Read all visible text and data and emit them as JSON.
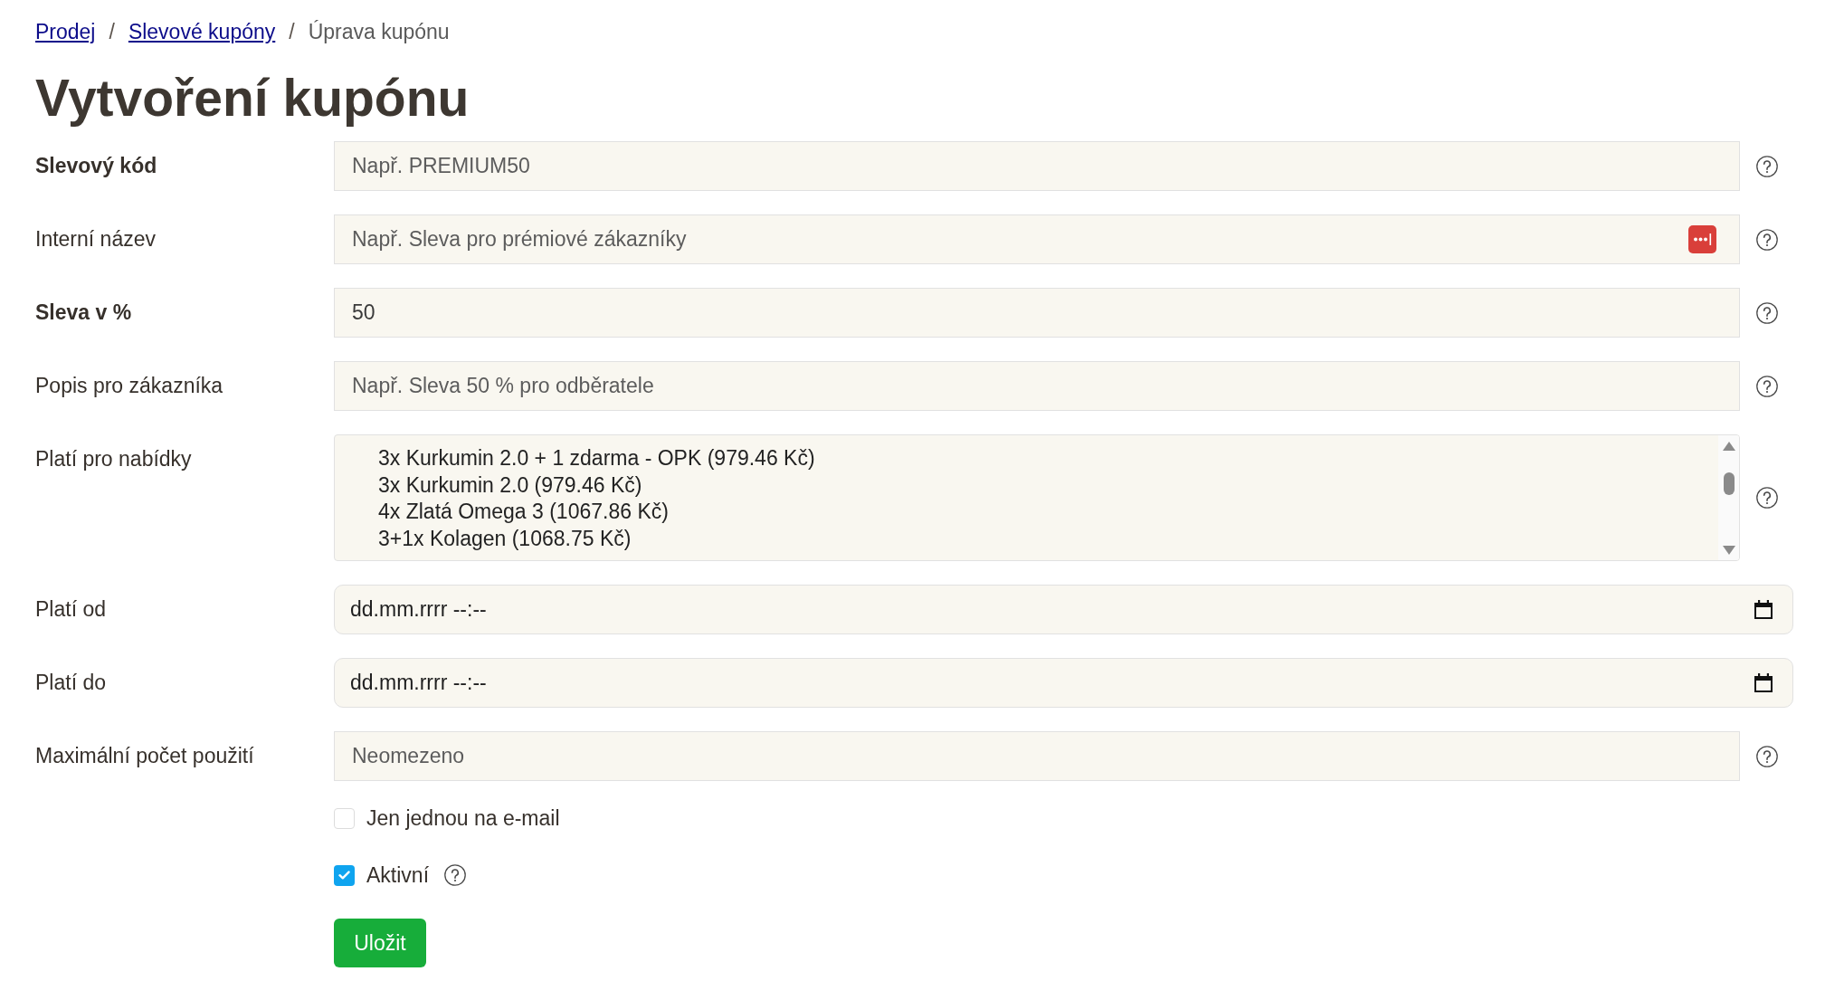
{
  "breadcrumb": [
    {
      "kind": "link",
      "text": "Prodej"
    },
    {
      "kind": "separator",
      "text": "/"
    },
    {
      "kind": "link",
      "text": "Slevové kupóny"
    },
    {
      "kind": "separator",
      "text": "/"
    },
    {
      "kind": "current",
      "text": "Úprava kupónu"
    }
  ],
  "title": "Vytvoření kupónu",
  "fields": [
    {
      "kind": "text",
      "label": "Slevový kód",
      "required": true,
      "placeholder": "Např. PREMIUM50",
      "help": true
    },
    {
      "kind": "text",
      "label": "Interní název",
      "required": false,
      "placeholder": "Např. Sleva pro prémiové zákazníky",
      "password_manager_icon": true,
      "help": true
    },
    {
      "kind": "text",
      "label": "Sleva v %",
      "required": true,
      "value": "50",
      "help": true
    },
    {
      "kind": "text",
      "label": "Popis pro zákazníka",
      "required": false,
      "placeholder": "Např. Sleva 50 % pro odběratele",
      "help": true
    },
    {
      "kind": "list",
      "label": "Platí pro nabídky",
      "required": false,
      "options": [
        {
          "text": "3x Kurkumin 2.0 + 1 zdarma - OPK (979.46 Kč)",
          "selected": false
        },
        {
          "text": "3x Kurkumin 2.0 (979.46 Kč)",
          "selected": false
        },
        {
          "text": "4x Zlatá Omega 3 (1067.86 Kč)",
          "selected": false
        },
        {
          "text": "3+1x Kolagen (1068.75 Kč)",
          "selected": false
        }
      ],
      "help": true
    },
    {
      "kind": "datetime",
      "label": "Platí od",
      "required": false,
      "placeholder": "dd.mm.rrrr --:--"
    },
    {
      "kind": "datetime",
      "label": "Platí do",
      "required": false,
      "placeholder": "dd.mm.rrrr --:--"
    },
    {
      "kind": "text",
      "label": "Maximální počet použití",
      "required": false,
      "placeholder": "Neomezeno",
      "help": true
    }
  ],
  "checkboxes": [
    {
      "label": "Jen jednou na e-mail",
      "checked": false
    },
    {
      "label": "Aktivní",
      "checked": true,
      "help": true
    }
  ],
  "save_button": "Uložit"
}
